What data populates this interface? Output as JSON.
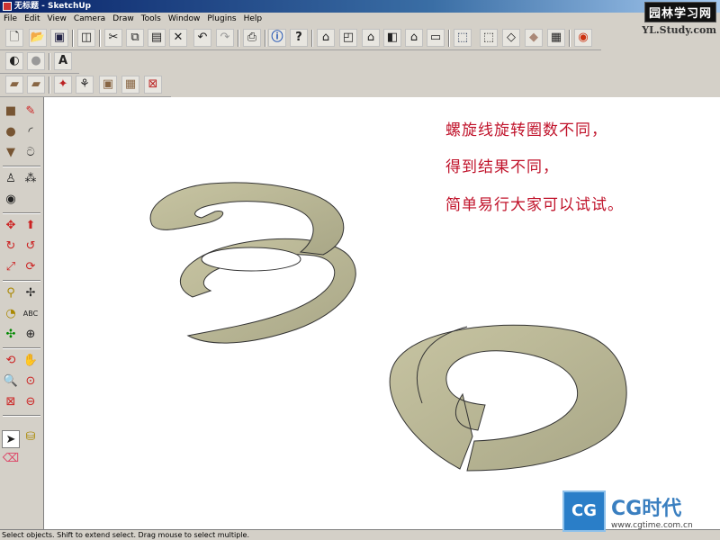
{
  "window": {
    "title": "无标题 - SketchUp"
  },
  "menu": [
    "File",
    "Edit",
    "View",
    "Camera",
    "Draw",
    "Tools",
    "Window",
    "Plugins",
    "Help"
  ],
  "watermarks": {
    "top_cn": "园林学习网",
    "top_en": "YL.Study.com",
    "cg_text": "CG时代",
    "cg_url": "www.cgtime.com.cn",
    "cg_box": "CG"
  },
  "canvas": {
    "annotation_lines": [
      "螺旋线旋转圈数不同，",
      "得到结果不同，",
      "简单易行大家可以试试。"
    ],
    "colors": {
      "surface": "#bdbb98",
      "surface_edge": "#333333",
      "text": "#c0122a"
    }
  },
  "toolbar_icons": {
    "row1": [
      "new-file-icon",
      "open-folder-icon",
      "save-icon",
      "make-component-icon",
      "cut-icon",
      "copy-icon",
      "paste-icon",
      "erase-icon",
      "undo-icon",
      "redo-icon",
      "print-icon",
      "model-info-icon",
      "help-icon",
      "iso-view-icon",
      "top-view-icon",
      "front-view-icon",
      "right-view-icon",
      "back-view-icon",
      "left-view-icon",
      "xray-icon",
      "wireframe-icon",
      "hidden-line-icon",
      "shaded-icon",
      "shaded-texture-icon",
      "google-earth-icon"
    ],
    "row2": [
      "shadows-icon",
      "fog-icon",
      "text-style-icon"
    ],
    "row3": [
      "section-plane-icon",
      "sandbox-icon",
      "follow-me-icon",
      "move-icon",
      "intersect-icon",
      "flip-icon",
      "close-icon"
    ]
  },
  "left_tools": [
    "rectangle-tool-icon",
    "line-tool-icon",
    "circle-tool-icon",
    "arc-tool-icon",
    "polygon-tool-icon",
    "freehand-tool-icon",
    "walk-tool-icon",
    "footprint-icon",
    "look-around-icon",
    "orbit-tool-icon",
    "push-pull-icon",
    "rotate-tool-icon",
    "follow-me-tool-icon",
    "scale-tool-icon",
    "offset-tool-icon",
    "tape-measure-icon",
    "axes-tool-icon",
    "protractor-icon",
    "dimension-tool-icon",
    "text-tool-icon",
    "3d-text-icon",
    "orbit-icon",
    "pan-hand-icon",
    "zoom-icon",
    "zoom-window-icon",
    "zoom-extents-icon",
    "previous-view-icon",
    "select-arrow-icon",
    "paint-bucket-icon",
    "eraser-icon"
  ],
  "status": {
    "text": "Select objects. Shift to extend select. Drag mouse to select multiple."
  }
}
